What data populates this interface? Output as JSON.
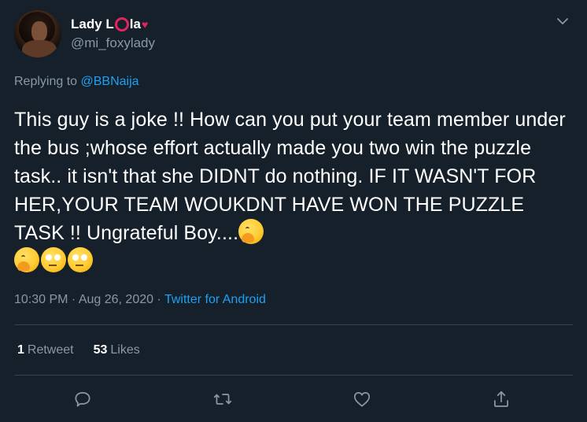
{
  "author": {
    "display_name_prefix": "Lady L",
    "display_name_suffix": "la",
    "handle": "@mi_foxylady"
  },
  "reply": {
    "prefix": "Replying to",
    "mention": "@BBNaija"
  },
  "tweet": {
    "text": "This guy is a joke !! How can you put your team member under the bus ;whose effort actually made you two win the puzzle task.. it isn't that she DIDNT do nothing. IF IT WASN'T FOR HER,YOUR TEAM WOUKDNT HAVE WON THE PUZZLE TASK !!  Ungrateful Boy....",
    "emojis": [
      "hand-over-mouth-emoji",
      "hand-over-mouth-emoji",
      "eye-roll-emoji",
      "eye-roll-emoji"
    ]
  },
  "meta": {
    "time_date": "10:30 PM · Aug 26, 2020 · ",
    "source": "Twitter for Android"
  },
  "stats": {
    "retweets_count": "1",
    "retweets_label": "Retweet",
    "likes_count": "53",
    "likes_label": "Likes"
  },
  "icons": {
    "reply": "speech-bubble-icon",
    "retweet": "retweet-icon",
    "like": "heart-icon",
    "share": "share-icon",
    "menu": "chevron-down-icon"
  },
  "colors": {
    "background": "#15202b",
    "text_primary": "#ffffff",
    "text_secondary": "#8899a6",
    "accent": "#1da1f2",
    "brand_red": "#e0245e",
    "divider": "#38444d"
  }
}
